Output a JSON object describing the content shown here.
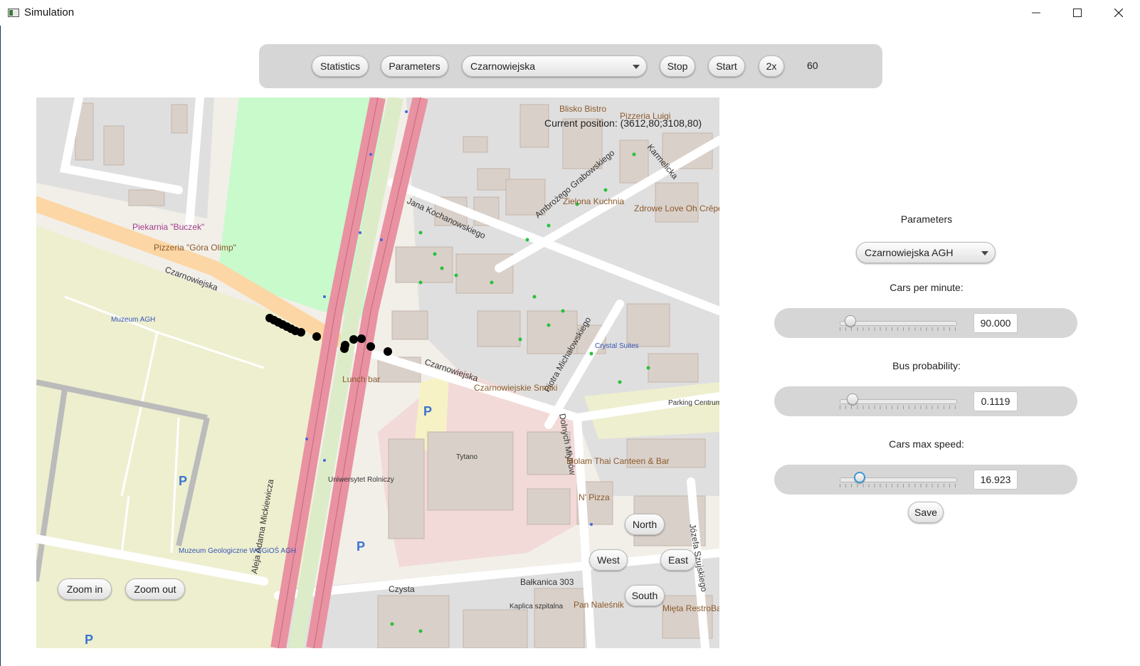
{
  "window": {
    "title": "Simulation",
    "controls": [
      "minimize",
      "maximize",
      "close"
    ]
  },
  "toolbar": {
    "statistics_label": "Statistics",
    "parameters_label": "Parameters",
    "location_selected": "Czarnowiejska",
    "stop_label": "Stop",
    "start_label": "Start",
    "speed_label": "2x",
    "counter_value": "60"
  },
  "map": {
    "position_text": "Current position: (3612,80;3108,80)",
    "zoom_in_label": "Zoom in",
    "zoom_out_label": "Zoom out",
    "nav": {
      "north": "North",
      "west": "West",
      "east": "East",
      "south": "South"
    },
    "street_labels": [
      "Czarnowiejska",
      "Jana Kochanowskiego",
      "Piotra Michałowskiego",
      "Aleja Adama Mickiewicza",
      "Czysta",
      "Dolnych Młynów",
      "Józefa Szujskiego",
      "Karmelicka",
      "Ambrożego Grabowskiego"
    ],
    "poi_labels": [
      "Piekarnia \"Buczek\"",
      "Pizzeria \"Góra Olimp\"",
      "Muzeum AGH",
      "Lunch bar",
      "Czarnowiejskie Smaki",
      "Uniwersytet Rolniczy",
      "Tytano",
      "Zielona Kuchnia",
      "Zdrowe Love Oh Crêpe",
      "Crystal Suites",
      "Parking Centrum",
      "Bałkanica 303",
      "Kaplica szpitalna",
      "Pan Naleśnik",
      "Mięta RestroBar",
      "Muzeum Geologiczne WGGiOŚ AGH",
      "Blisko Bistro",
      "Pizzeria Luigi",
      "Molam Thai Canteen & Bar",
      "N' Pizza"
    ],
    "colors": {
      "background": "#f2efe9",
      "park": "#c8facc",
      "campus": "#eeefcf",
      "building": "#d9d0c9",
      "building_dark": "#c4b6ab",
      "major_road": "#e892a2",
      "secondary_road": "#fcd6a4",
      "car": "#000000"
    }
  },
  "parameters": {
    "title": "Parameters",
    "intersection_selected": "Czarnowiejska AGH",
    "cars_per_minute": {
      "label": "Cars per minute:",
      "value": "90.000",
      "fraction": 0.09
    },
    "bus_probability": {
      "label": "Bus probability:",
      "value": "0.1119",
      "fraction": 0.11
    },
    "cars_max_speed": {
      "label": "Cars max speed:",
      "value": "16.923",
      "fraction": 0.17
    },
    "save_label": "Save"
  }
}
